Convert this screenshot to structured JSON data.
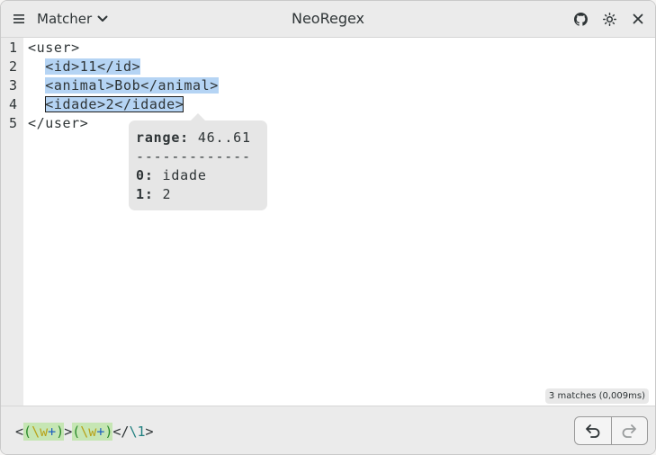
{
  "app": {
    "title": "NeoRegex",
    "mode_label": "Matcher"
  },
  "editor": {
    "line_numbers": [
      "1",
      "2",
      "3",
      "4",
      "5"
    ],
    "lines": [
      {
        "indent": "",
        "text": "<user>"
      },
      {
        "indent": "  ",
        "text": "<id>11</id>"
      },
      {
        "indent": "  ",
        "text": "<animal>Bob</animal>"
      },
      {
        "indent": "  ",
        "text": "<idade>2</idade>"
      },
      {
        "indent": "",
        "text": "</user>"
      }
    ]
  },
  "popover": {
    "range_key": "range:",
    "range_value": "46..61",
    "separator": "-------------",
    "groups": [
      {
        "key": "0:",
        "value": "idade"
      },
      {
        "key": "1:",
        "value": "2"
      }
    ]
  },
  "status": {
    "matches": "3 matches (0,009ms)"
  },
  "regex": {
    "lt": "<",
    "open1": "(",
    "class1": "\\w",
    "quant1": "+",
    "close1": ")",
    "gt": ">",
    "open2": "(",
    "class2": "\\w",
    "quant2": "+",
    "close2": ")",
    "close_tag": "</",
    "backref": "\\1",
    "end": ">"
  },
  "icons": {
    "menu": "hamburger-menu-icon",
    "mode_dropdown": "chevron-down-icon",
    "github": "github-icon",
    "theme": "sun-icon",
    "close": "close-icon",
    "undo": "undo-icon",
    "redo": "redo-icon"
  }
}
